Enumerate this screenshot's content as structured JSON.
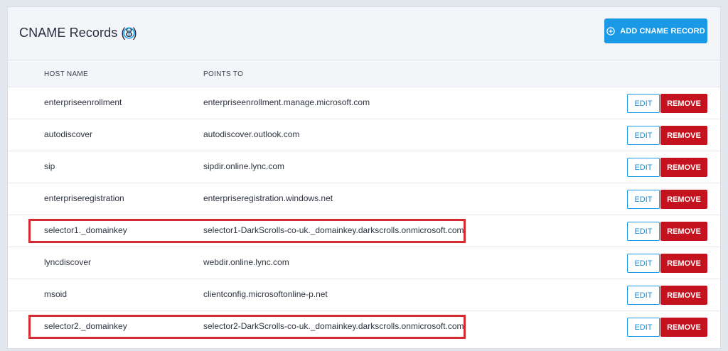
{
  "header": {
    "title": "CNAME Records (8)",
    "add_button_label": "ADD CNAME RECORD"
  },
  "table": {
    "columns": {
      "host": "HOST NAME",
      "points": "POINTS TO"
    },
    "edit_label": "EDIT",
    "remove_label": "REMOVE",
    "rows": [
      {
        "host": "enterpriseenrollment",
        "points": "enterpriseenrollment.manage.microsoft.com",
        "highlighted": false
      },
      {
        "host": "autodiscover",
        "points": "autodiscover.outlook.com",
        "highlighted": false
      },
      {
        "host": "sip",
        "points": "sipdir.online.lync.com",
        "highlighted": false
      },
      {
        "host": "enterpriseregistration",
        "points": "enterpriseregistration.windows.net",
        "highlighted": false
      },
      {
        "host": "selector1._domainkey",
        "points": "selector1-DarkScrolls-co-uk._domainkey.darkscrolls.onmicrosoft.com",
        "highlighted": true
      },
      {
        "host": "lyncdiscover",
        "points": "webdir.online.lync.com",
        "highlighted": false
      },
      {
        "host": "msoid",
        "points": "clientconfig.microsoftonline-p.net",
        "highlighted": false
      },
      {
        "host": "selector2._domainkey",
        "points": "selector2-DarkScrolls-co-uk._domainkey.darkscrolls.onmicrosoft.com",
        "highlighted": true
      }
    ]
  },
  "icons": {
    "info": "info-icon",
    "add": "plus-circle-icon"
  },
  "colors": {
    "accent": "#1a9ae6",
    "danger": "#c4121f",
    "highlight": "#d42a32"
  }
}
